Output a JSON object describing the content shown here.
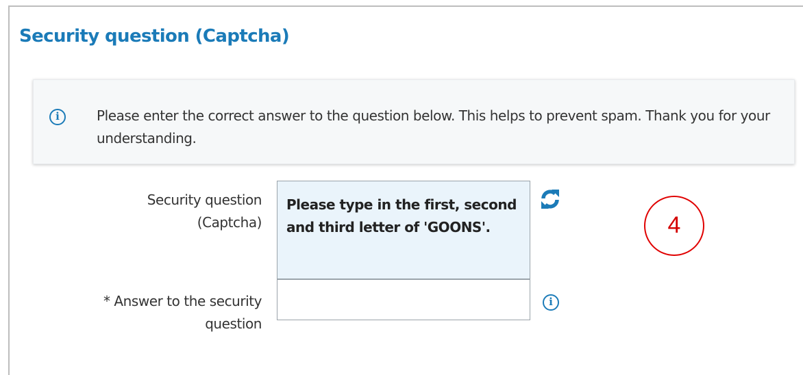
{
  "section": {
    "title": "Security question (Captcha)"
  },
  "info": {
    "icon": "info-circle-icon",
    "text": "Please enter the correct answer to the question below. This helps to prevent spam. Thank you for your understanding."
  },
  "captcha": {
    "label_line1": "Security question",
    "label_line2": "(Captcha)",
    "question": "Please type in the first, second and third letter of 'GOONS'.",
    "refresh_icon": "refresh-icon"
  },
  "answer": {
    "label_line1": "* Answer to the security",
    "label_line2": "question",
    "value": "",
    "help_icon": "info-circle-icon"
  },
  "annotation": {
    "step_number": "4"
  },
  "colors": {
    "accent": "#1b7bb8",
    "captcha_bg": "#eaf4fb",
    "info_bg": "#f6f8f9",
    "marker": "#e00000"
  }
}
